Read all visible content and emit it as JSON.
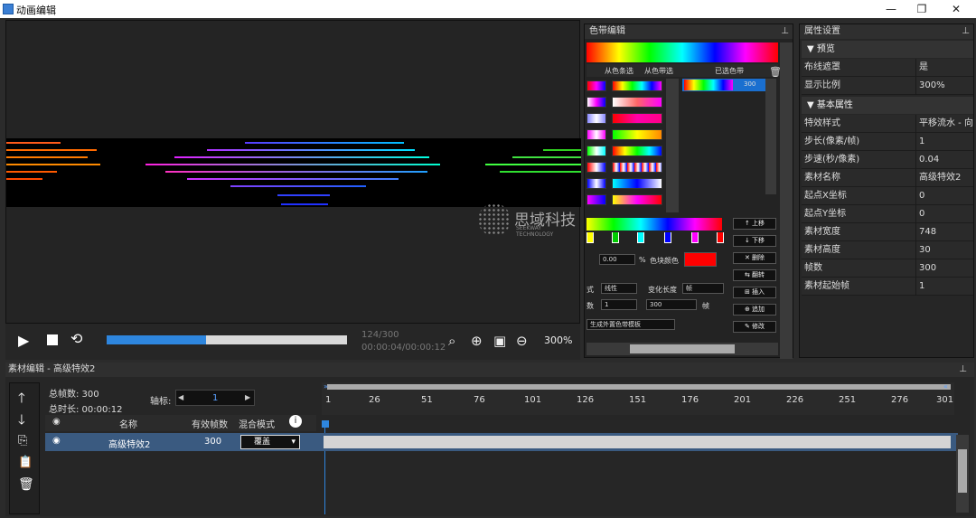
{
  "window": {
    "title": "动画编辑",
    "min": "—",
    "max": "❐",
    "close": "✕"
  },
  "watermark": {
    "cn": "思域科技",
    "en": "SEEKWAY TECHNOLOGY"
  },
  "playback": {
    "frame": "124/300",
    "time": "00:00:04/00:00:12",
    "zoom": "300%",
    "progress": 0.413
  },
  "colorband": {
    "title": "色带编辑",
    "tabs": [
      "从色条选",
      "从色带选",
      "已选色带"
    ],
    "selected_count": "300",
    "pos_value": "0.00",
    "pos_unit": "%",
    "color_label": "色块颜色",
    "buttons": [
      "上移",
      "下移",
      "删除",
      "翻转",
      "插入",
      "追加",
      "修改"
    ],
    "mode_label": "式",
    "mode_value": "线性",
    "change_label": "变化长度",
    "change_unit_value": "帧",
    "count_label": "数",
    "count_value": "1",
    "length_value": "300",
    "length_unit": "帧",
    "gen_button": "生成外置色带模板",
    "band_color": "#ff0000"
  },
  "properties": {
    "title": "属性设置",
    "group_preview": "预览",
    "preview": [
      {
        "k": "布线遮罩",
        "v": "是"
      },
      {
        "k": "显示比例",
        "v": "300%"
      }
    ],
    "group_basic": "基本属性",
    "basic": [
      {
        "k": "特效样式",
        "v": "平移流水 - 向"
      },
      {
        "k": "步长(像素/帧)",
        "v": "1"
      },
      {
        "k": "步速(秒/像素)",
        "v": "0.04"
      },
      {
        "k": "素材名称",
        "v": "高级特效2"
      },
      {
        "k": "起点X坐标",
        "v": "0"
      },
      {
        "k": "起点Y坐标",
        "v": "0"
      },
      {
        "k": "素材宽度",
        "v": "748"
      },
      {
        "k": "素材高度",
        "v": "30"
      },
      {
        "k": "帧数",
        "v": "300"
      },
      {
        "k": "素材起始帧",
        "v": "1"
      }
    ]
  },
  "material": {
    "title": "素材编辑 - 高级特效2",
    "total_frames": "总帧数: 300",
    "total_time": "总时长: 00:00:12",
    "axis_label": "轴标:",
    "axis_value": "1",
    "ruler": [
      "1",
      "26",
      "51",
      "76",
      "101",
      "126",
      "151",
      "176",
      "201",
      "226",
      "251",
      "276",
      "301"
    ],
    "cols": {
      "name": "名称",
      "frames": "有效帧数",
      "blend": "混合模式"
    },
    "layer": {
      "name": "高级特效2",
      "frames": "300",
      "blend": "覆盖"
    }
  }
}
